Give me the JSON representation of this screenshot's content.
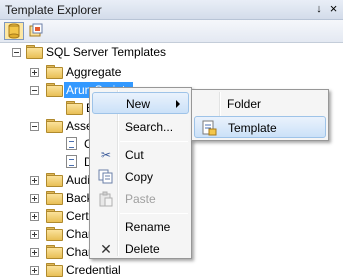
{
  "window": {
    "title": "Template Explorer",
    "pin_glyph": "↓",
    "close_glyph": "×"
  },
  "toolbar": {
    "buttons": [
      {
        "icon": "sql-server-templates-icon"
      },
      {
        "icon": "analysis-server-templates-icon"
      }
    ]
  },
  "tree": {
    "root": "SQL Server Templates",
    "items": [
      {
        "label": "Aggregate"
      },
      {
        "label": "Arun Scripts",
        "state": "selected"
      },
      {
        "label": "B"
      },
      {
        "label": "Asse"
      },
      {
        "label": "C"
      },
      {
        "label": "D"
      },
      {
        "label": "Audi"
      },
      {
        "label": "Back"
      },
      {
        "label": "Certi"
      },
      {
        "label": "Chan"
      },
      {
        "label": "Chan"
      },
      {
        "label": "Credential"
      }
    ]
  },
  "context_menu": {
    "items": [
      {
        "label": "New",
        "has_submenu": true
      },
      {
        "label": "Search..."
      },
      {
        "label": "Cut",
        "icon": "scissors-icon"
      },
      {
        "label": "Copy",
        "icon": "copy-icon"
      },
      {
        "label": "Paste",
        "icon": "paste-icon",
        "disabled": true
      },
      {
        "label": "Rename"
      },
      {
        "label": "Delete",
        "icon": "delete-x-icon"
      }
    ],
    "icons": {
      "cut": "✂",
      "delete": "✕"
    }
  },
  "submenu": {
    "items": [
      {
        "label": "Folder"
      },
      {
        "label": "Template",
        "icon": "template-icon",
        "highlighted": true
      }
    ]
  }
}
